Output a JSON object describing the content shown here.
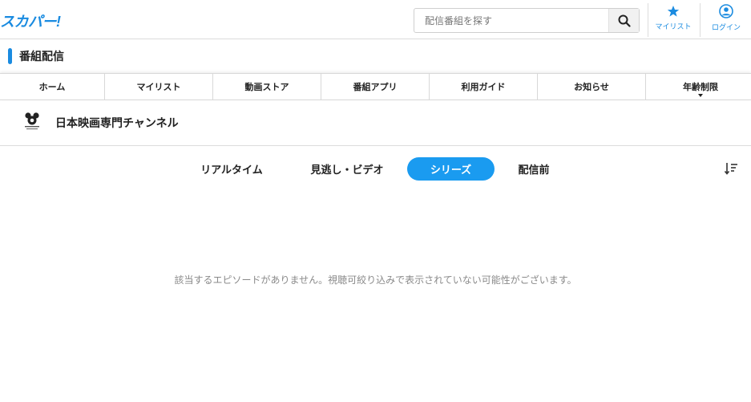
{
  "header": {
    "logo": "スカパー!",
    "search": {
      "placeholder": "配信番組を探す",
      "value": ""
    },
    "mylist_label": "マイリスト",
    "login_label": "ログイン"
  },
  "section": {
    "title": "番組配信"
  },
  "nav": {
    "items": [
      "ホーム",
      "マイリスト",
      "動画ストア",
      "番組アプリ",
      "利用ガイド",
      "お知らせ",
      "年齢制限"
    ]
  },
  "channel": {
    "name": "日本映画専門チャンネル"
  },
  "tabs": {
    "items": [
      "リアルタイム",
      "見逃し・ビデオ",
      "シリーズ",
      "配信前"
    ],
    "active": "シリーズ"
  },
  "empty_message": "該当するエピソードがありません。視聴可絞り込みで表示されていない可能性がございます。",
  "colors": {
    "accent": "#1a8be0",
    "active_tab": "#1a9bf0"
  }
}
